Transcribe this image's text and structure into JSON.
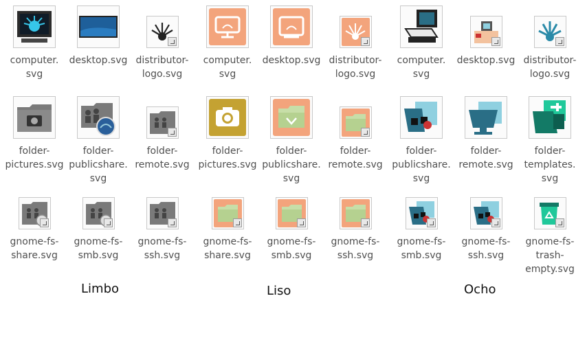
{
  "files": [
    {
      "label_lines": [
        "computer.",
        "svg"
      ],
      "icon": "limbo-computer-icon"
    },
    {
      "label_lines": [
        "desktop.svg"
      ],
      "icon": "limbo-desktop-icon"
    },
    {
      "label_lines": [
        "distributor-",
        "logo.svg"
      ],
      "icon": "limbo-distributor-logo-icon"
    },
    {
      "label_lines": [
        "computer.",
        "svg"
      ],
      "icon": "liso-computer-icon"
    },
    {
      "label_lines": [
        "desktop.svg"
      ],
      "icon": "liso-desktop-icon"
    },
    {
      "label_lines": [
        "distributor-",
        "logo.svg"
      ],
      "icon": "liso-distributor-logo-icon"
    },
    {
      "label_lines": [
        "computer.",
        "svg"
      ],
      "icon": "ocho-computer-icon"
    },
    {
      "label_lines": [
        "desktop.svg"
      ],
      "icon": "ocho-desktop-icon"
    },
    {
      "label_lines": [
        "distributor-",
        "logo.svg"
      ],
      "icon": "ocho-distributor-logo-icon"
    },
    {
      "label_lines": [
        "folder-",
        "pictures.svg"
      ],
      "icon": "limbo-folder-pictures-icon"
    },
    {
      "label_lines": [
        "folder-",
        "publicshare.",
        "svg"
      ],
      "icon": "limbo-folder-publicshare-icon"
    },
    {
      "label_lines": [
        "folder-",
        "remote.svg"
      ],
      "icon": "limbo-folder-remote-icon"
    },
    {
      "label_lines": [
        "folder-",
        "pictures.svg"
      ],
      "icon": "liso-folder-pictures-icon"
    },
    {
      "label_lines": [
        "folder-",
        "publicshare.",
        "svg"
      ],
      "icon": "liso-folder-publicshare-icon"
    },
    {
      "label_lines": [
        "folder-",
        "remote.svg"
      ],
      "icon": "liso-folder-remote-icon"
    },
    {
      "label_lines": [
        "folder-",
        "publicshare.",
        "svg"
      ],
      "icon": "ocho-folder-publicshare-icon"
    },
    {
      "label_lines": [
        "folder-",
        "remote.svg"
      ],
      "icon": "ocho-folder-remote-icon"
    },
    {
      "label_lines": [
        "folder-",
        "templates.",
        "svg"
      ],
      "icon": "ocho-folder-templates-icon"
    },
    {
      "label_lines": [
        "gnome-fs-",
        "share.svg"
      ],
      "icon": "limbo-gnome-fs-share-icon"
    },
    {
      "label_lines": [
        "gnome-fs-",
        "smb.svg"
      ],
      "icon": "limbo-gnome-fs-smb-icon"
    },
    {
      "label_lines": [
        "gnome-fs-",
        "ssh.svg"
      ],
      "icon": "limbo-gnome-fs-ssh-icon"
    },
    {
      "label_lines": [
        "gnome-fs-",
        "share.svg"
      ],
      "icon": "liso-gnome-fs-share-icon"
    },
    {
      "label_lines": [
        "gnome-fs-",
        "smb.svg"
      ],
      "icon": "liso-gnome-fs-smb-icon"
    },
    {
      "label_lines": [
        "gnome-fs-",
        "ssh.svg"
      ],
      "icon": "liso-gnome-fs-ssh-icon"
    },
    {
      "label_lines": [
        "gnome-fs-",
        "smb.svg"
      ],
      "icon": "ocho-gnome-fs-smb-icon"
    },
    {
      "label_lines": [
        "gnome-fs-",
        "ssh.svg"
      ],
      "icon": "ocho-gnome-fs-ssh-icon"
    },
    {
      "label_lines": [
        "gnome-fs-",
        "trash-",
        "empty.svg"
      ],
      "icon": "ocho-gnome-fs-trash-empty-icon"
    }
  ],
  "groups": {
    "limbo": "Limbo",
    "liso": "Liso",
    "ocho": "Ocho"
  },
  "colors": {
    "liso_orange": "#f3a47c",
    "liso_green": "#c7dea8",
    "ocho_teal": "#2a6e86",
    "ocho_light_blue": "#8fd0e0",
    "ocho_mint": "#20c89a",
    "limbo_gray": "#7a7a7a"
  }
}
